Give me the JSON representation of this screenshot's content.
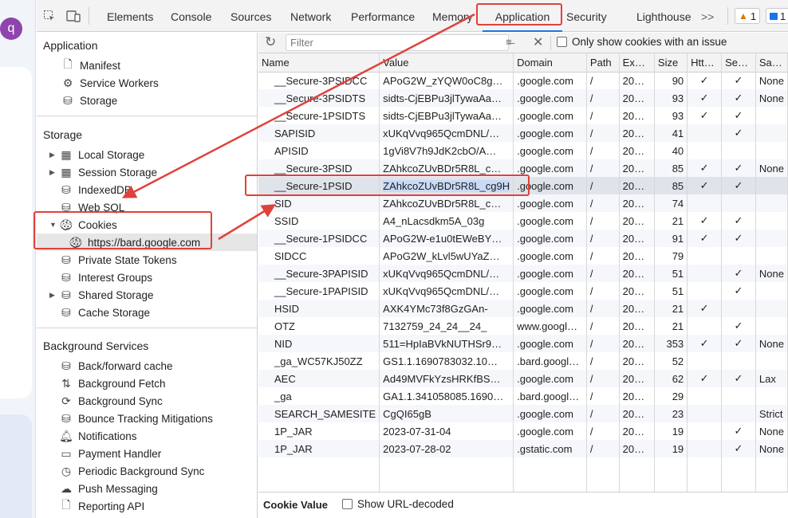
{
  "left_strip": {
    "avatar_letter": "q"
  },
  "tabs": {
    "items": [
      "Elements",
      "Console",
      "Sources",
      "Network",
      "Performance",
      "Memory",
      "Application",
      "Security",
      "Lighthouse"
    ],
    "more": ">>",
    "warnings": "1",
    "messages": "1"
  },
  "sidebar": {
    "application": {
      "title": "Application",
      "items": [
        "Manifest",
        "Service Workers",
        "Storage"
      ]
    },
    "storage": {
      "title": "Storage",
      "items": [
        "Local Storage",
        "Session Storage",
        "IndexedDB",
        "Web SQL",
        "Cookies",
        "https://bard.google.com",
        "Private State Tokens",
        "Interest Groups",
        "Shared Storage",
        "Cache Storage"
      ]
    },
    "background": {
      "title": "Background Services",
      "items": [
        "Back/forward cache",
        "Background Fetch",
        "Background Sync",
        "Bounce Tracking Mitigations",
        "Notifications",
        "Payment Handler",
        "Periodic Background Sync",
        "Push Messaging",
        "Reporting API"
      ]
    }
  },
  "toolbar": {
    "filter_placeholder": "Filter",
    "only_issue_label": "Only show cookies with an issue"
  },
  "table": {
    "headers": [
      "Name",
      "Value",
      "Domain",
      "Path",
      "Ex…",
      "Size",
      "Htt…",
      "Se…",
      "Sa…"
    ],
    "rows": [
      [
        "__Secure-3PSIDCC",
        "APoG2W_zYQW0oC8g…",
        ".google.com",
        "/",
        "20…",
        "90",
        "✓",
        "✓",
        "None"
      ],
      [
        "__Secure-3PSIDTS",
        "sidts-CjEBPu3jlTywaAa…",
        ".google.com",
        "/",
        "20…",
        "93",
        "✓",
        "✓",
        "None"
      ],
      [
        "__Secure-1PSIDTS",
        "sidts-CjEBPu3jlTywaAa…",
        ".google.com",
        "/",
        "20…",
        "93",
        "✓",
        "✓",
        ""
      ],
      [
        "SAPISID",
        "xUKqVvq965QcmDNL/…",
        ".google.com",
        "/",
        "20…",
        "41",
        "",
        "✓",
        ""
      ],
      [
        "APISID",
        "1gVi8V7h9JdK2cbO/A…",
        ".google.com",
        "/",
        "20…",
        "40",
        "",
        "",
        ""
      ],
      [
        "__Secure-3PSID",
        "ZAhkcoZUvBDr5R8L_c…",
        ".google.com",
        "/",
        "20…",
        "85",
        "✓",
        "✓",
        "None"
      ],
      [
        "__Secure-1PSID",
        "ZAhkcoZUvBDr5R8L_cg9H",
        ".google.com",
        "/",
        "20…",
        "85",
        "✓",
        "✓",
        ""
      ],
      [
        "SID",
        "ZAhkcoZUvBDr5R8L_c…",
        ".google.com",
        "/",
        "20…",
        "74",
        "",
        "",
        ""
      ],
      [
        "SSID",
        "A4_nLacsdkm5A_03g",
        ".google.com",
        "/",
        "20…",
        "21",
        "✓",
        "✓",
        ""
      ],
      [
        "__Secure-1PSIDCC",
        "APoG2W-e1u0tEWeBY…",
        ".google.com",
        "/",
        "20…",
        "91",
        "✓",
        "✓",
        ""
      ],
      [
        "SIDCC",
        "APoG2W_kLvl5wUYaZ…",
        ".google.com",
        "/",
        "20…",
        "79",
        "",
        "",
        ""
      ],
      [
        "__Secure-3PAPISID",
        "xUKqVvq965QcmDNL/…",
        ".google.com",
        "/",
        "20…",
        "51",
        "",
        "✓",
        "None"
      ],
      [
        "__Secure-1PAPISID",
        "xUKqVvq965QcmDNL/…",
        ".google.com",
        "/",
        "20…",
        "51",
        "",
        "✓",
        ""
      ],
      [
        "HSID",
        "AXK4YMc73f8GzGAn-",
        ".google.com",
        "/",
        "20…",
        "21",
        "✓",
        "",
        ""
      ],
      [
        "OTZ",
        "7132759_24_24__24_",
        "www.googl…",
        "/",
        "20…",
        "21",
        "",
        "✓",
        ""
      ],
      [
        "NID",
        "511=HpIaBVkNUTHSr9…",
        ".google.com",
        "/",
        "20…",
        "353",
        "✓",
        "✓",
        "None"
      ],
      [
        "_ga_WC57KJ50ZZ",
        "GS1.1.1690783032.10…",
        ".bard.googl…",
        "/",
        "20…",
        "52",
        "",
        "",
        ""
      ],
      [
        "AEC",
        "Ad49MVFkYzsHRKfBS…",
        ".google.com",
        "/",
        "20…",
        "62",
        "✓",
        "✓",
        "Lax"
      ],
      [
        "_ga",
        "GA1.1.341058085.1690…",
        ".bard.googl…",
        "/",
        "20…",
        "29",
        "",
        "",
        ""
      ],
      [
        "SEARCH_SAMESITE",
        "CgQI65gB",
        ".google.com",
        "/",
        "20…",
        "23",
        "",
        "",
        "Strict"
      ],
      [
        "1P_JAR",
        "2023-07-31-04",
        ".google.com",
        "/",
        "20…",
        "19",
        "",
        "✓",
        "None"
      ],
      [
        "1P_JAR",
        "2023-07-28-02",
        ".gstatic.com",
        "/",
        "20…",
        "19",
        "",
        "✓",
        "None"
      ]
    ],
    "selected_row": 6
  },
  "cookie_value": {
    "title": "Cookie Value",
    "show_decoded_label": "Show URL-decoded"
  },
  "colors": {
    "accent": "#1a73e8",
    "annotation": "#e0413b",
    "avatar": "#8e44ad"
  }
}
